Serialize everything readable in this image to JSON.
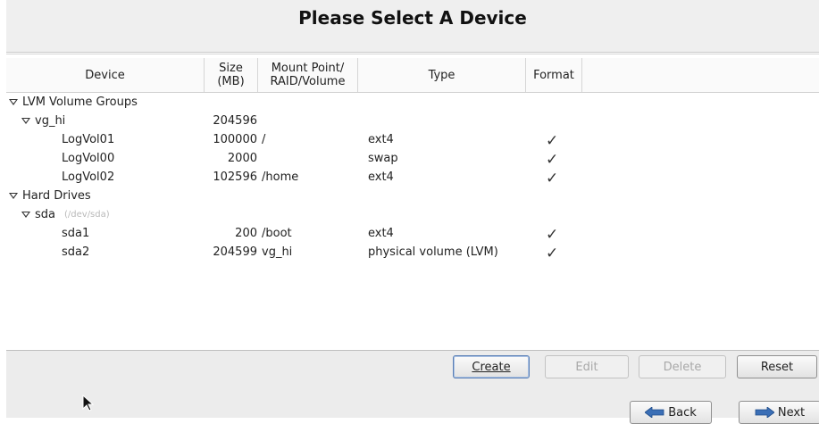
{
  "title": "Please Select A Device",
  "columns": {
    "device": "Device",
    "size": "Size\n(MB)",
    "mount": "Mount Point/\nRAID/Volume",
    "type": "Type",
    "format": "Format"
  },
  "rows": [
    {
      "device": "LVM Volume Groups",
      "size": "",
      "mount": "",
      "type": "",
      "format": false,
      "expander": true,
      "level": 0
    },
    {
      "device": "vg_hi",
      "size": "204596",
      "mount": "",
      "type": "",
      "format": false,
      "expander": true,
      "level": 1
    },
    {
      "device": "LogVol01",
      "size": "100000",
      "mount": "/",
      "type": "ext4",
      "format": true,
      "expander": false,
      "level": 2
    },
    {
      "device": "LogVol00",
      "size": "2000",
      "mount": "",
      "type": "swap",
      "format": true,
      "expander": false,
      "level": 2
    },
    {
      "device": "LogVol02",
      "size": "102596",
      "mount": "/home",
      "type": "ext4",
      "format": true,
      "expander": false,
      "level": 2
    },
    {
      "device": "Hard Drives",
      "size": "",
      "mount": "",
      "type": "",
      "format": false,
      "expander": true,
      "level": 0
    },
    {
      "device": "sda",
      "sub": "(/dev/sda)",
      "size": "",
      "mount": "",
      "type": "",
      "format": false,
      "expander": true,
      "level": 1
    },
    {
      "device": "sda1",
      "size": "200",
      "mount": "/boot",
      "type": "ext4",
      "format": true,
      "expander": false,
      "level": 2
    },
    {
      "device": "sda2",
      "size": "204599",
      "mount": "vg_hi",
      "type": "physical volume (LVM)",
      "format": true,
      "expander": false,
      "level": 2
    }
  ],
  "check_glyph": "✓",
  "buttons": {
    "create": "Create",
    "edit": "Edit",
    "delete": "Delete",
    "reset": "Reset",
    "back": "Back",
    "next": "Next"
  },
  "icons": {
    "back": "left-arrow-icon",
    "next": "right-arrow-icon",
    "cursor": "mouse-pointer-icon"
  }
}
